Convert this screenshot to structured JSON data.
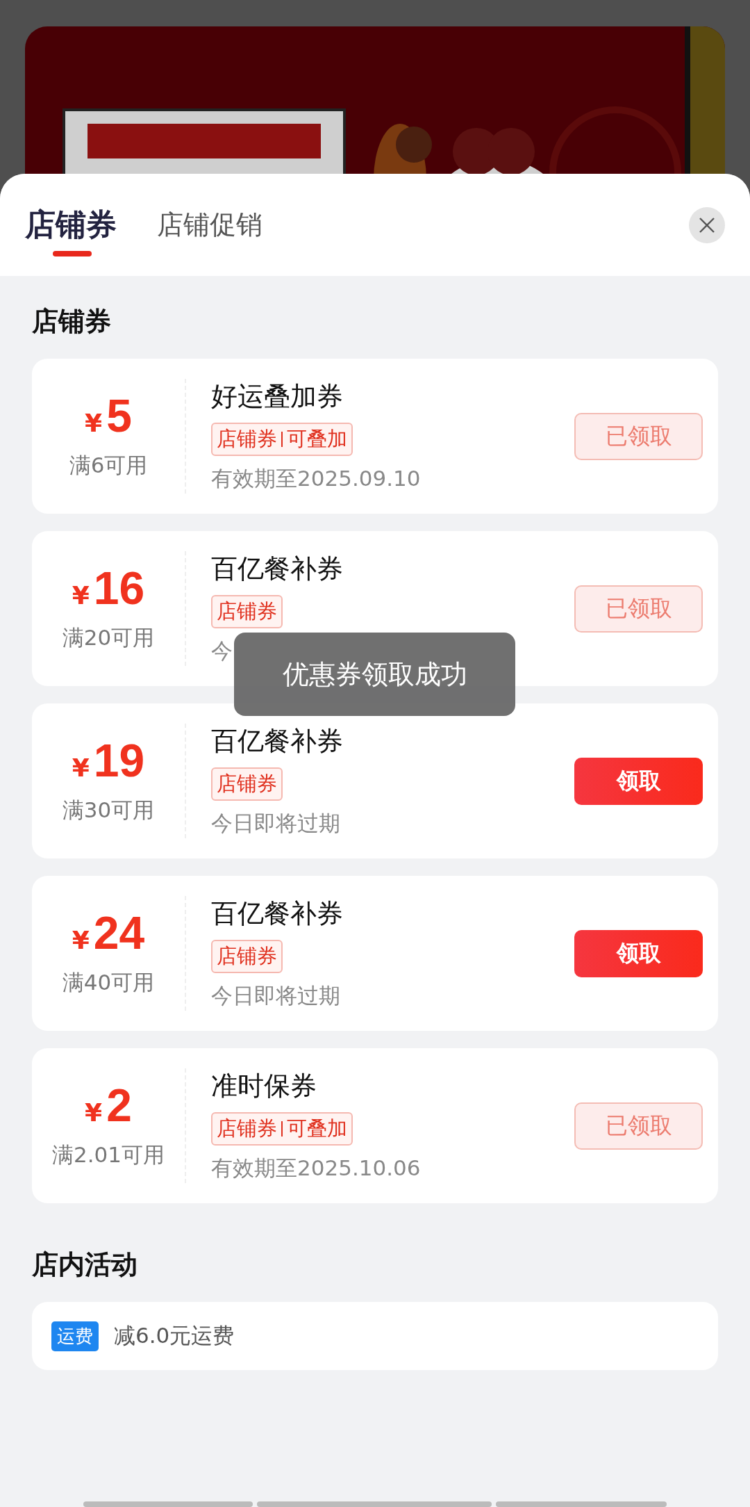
{
  "tabs": [
    {
      "label": "店铺券",
      "selected": true
    },
    {
      "label": "店铺促销",
      "selected": false
    }
  ],
  "coupon_section": {
    "title": "店铺券",
    "coupons": [
      {
        "currency": "¥",
        "amount": "5",
        "condition": "满6可用",
        "name": "好运叠加券",
        "tags": [
          "店铺券",
          "可叠加"
        ],
        "validity": "有效期至2025.09.10",
        "button": "已领取",
        "claimed": true
      },
      {
        "currency": "¥",
        "amount": "16",
        "condition": "满20可用",
        "name": "百亿餐补券",
        "tags": [
          "店铺券"
        ],
        "validity": "今",
        "button": "已领取",
        "claimed": true
      },
      {
        "currency": "¥",
        "amount": "19",
        "condition": "满30可用",
        "name": "百亿餐补券",
        "tags": [
          "店铺券"
        ],
        "validity": "今日即将过期",
        "button": "领取",
        "claimed": false
      },
      {
        "currency": "¥",
        "amount": "24",
        "condition": "满40可用",
        "name": "百亿餐补券",
        "tags": [
          "店铺券"
        ],
        "validity": "今日即将过期",
        "button": "领取",
        "claimed": false
      },
      {
        "currency": "¥",
        "amount": "2",
        "condition": "满2.01可用",
        "name": "准时保券",
        "tags": [
          "店铺券",
          "可叠加"
        ],
        "validity": "有效期至2025.10.06",
        "button": "已领取",
        "claimed": true
      }
    ]
  },
  "activity_section": {
    "title": "店内活动",
    "items": [
      {
        "tag": "运费",
        "text": "减6.0元运费"
      }
    ]
  },
  "toast": "优惠券领取成功"
}
